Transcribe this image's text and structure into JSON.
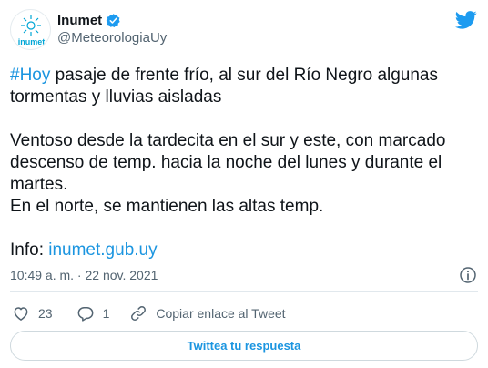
{
  "header": {
    "display_name": "Inumet",
    "handle": "@MeteorologiaUy",
    "avatar_text": "inumet"
  },
  "body": {
    "hashtag": "#Hoy",
    "line1_rest": " pasaje de frente frío, al sur del Río Negro algunas tormentas y lluvias aisladas",
    "para2": "Ventoso desde la tardecita en el sur y este, con marcado descenso de temp. hacia la noche del lunes y durante el martes.",
    "para3": "En el norte, se mantienen las altas temp.",
    "info_label": "Info: ",
    "info_link": "inumet.gub.uy"
  },
  "meta": {
    "timestamp": "10:49 a. m. · 22 nov. 2021"
  },
  "actions": {
    "like_count": "23",
    "reply_count": "1",
    "copy_link_label": "Copiar enlace al Tweet"
  },
  "reply_button": {
    "label": "Twittea tu respuesta"
  },
  "colors": {
    "link": "#1b95e0",
    "verified": "#1d9bf0",
    "secondary_text": "#536471",
    "avatar_brand": "#00a6d6"
  },
  "icons": [
    "verified-badge-icon",
    "twitter-bird-icon",
    "info-icon",
    "heart-icon",
    "reply-bubble-icon",
    "link-icon"
  ]
}
